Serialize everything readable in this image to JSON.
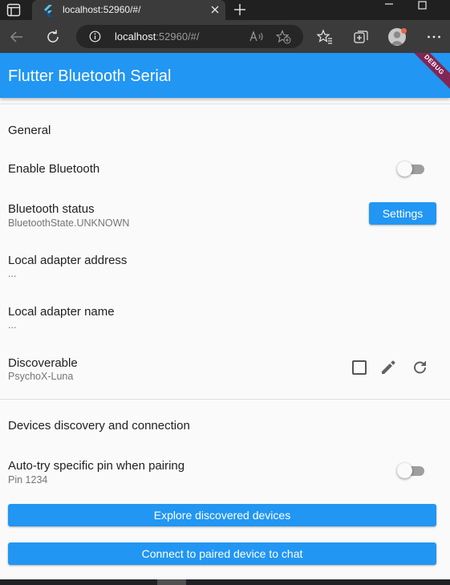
{
  "browser": {
    "tab_title": "localhost:52960/#/",
    "url_host": "localhost",
    "url_rest": ":52960/#/"
  },
  "app": {
    "title": "Flutter Bluetooth Serial",
    "debug_banner": "DEBUG",
    "accent_color": "#2196f3"
  },
  "general": {
    "section_title": "General",
    "enable_bluetooth": {
      "label": "Enable Bluetooth",
      "enabled": false
    },
    "bluetooth_status": {
      "label": "Bluetooth status",
      "value": "BluetoothState.UNKNOWN",
      "button": "Settings"
    },
    "local_address": {
      "label": "Local adapter address",
      "value": "..."
    },
    "local_name": {
      "label": "Local adapter name",
      "value": "..."
    },
    "discoverable": {
      "label": "Discoverable",
      "value": "PsychoX-Luna",
      "checked": false
    }
  },
  "devices": {
    "section_title": "Devices discovery and connection",
    "auto_pin": {
      "label": "Auto-try specific pin when pairing",
      "value": "Pin 1234",
      "enabled": false
    },
    "explore_button": "Explore discovered devices",
    "connect_button": "Connect to paired device to chat"
  },
  "icons": {
    "tab_actions": "tab-actions-icon",
    "favicon": "flutter-icon",
    "close": "close-icon",
    "new_tab": "plus-icon",
    "back": "back-arrow-icon",
    "refresh": "refresh-icon",
    "info": "info-icon",
    "read_aloud": "read-aloud-icon",
    "add_favorite": "add-favorite-icon",
    "favorites": "favorites-icon",
    "collections": "collections-icon",
    "more": "more-icon",
    "edit": "pencil-icon",
    "checkbox": "checkbox-icon"
  }
}
